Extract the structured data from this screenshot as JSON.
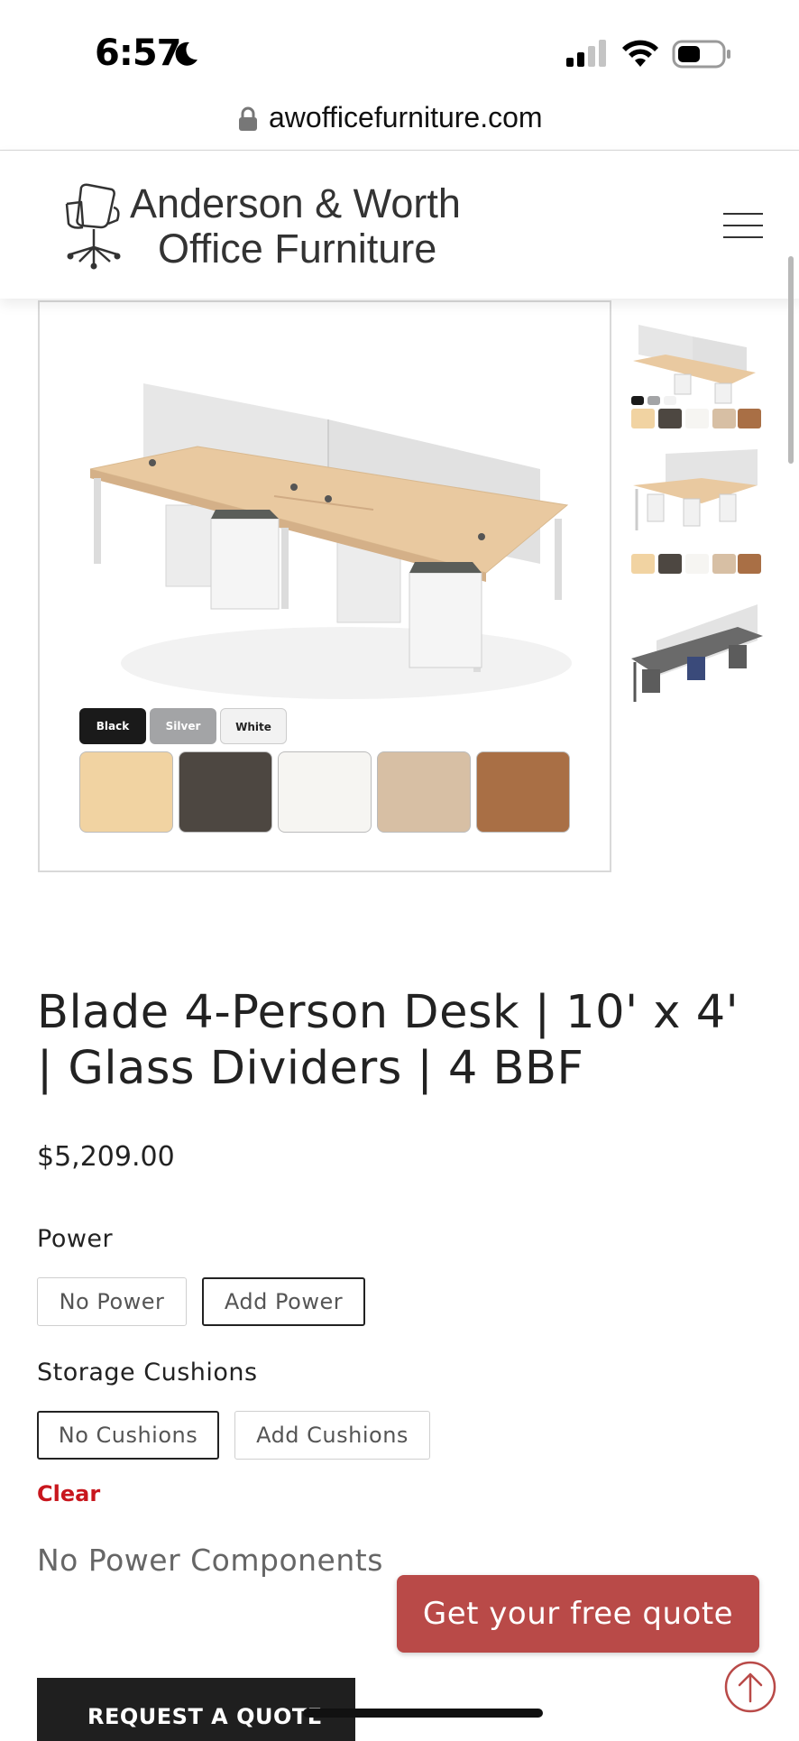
{
  "status_bar": {
    "time": "6:57",
    "moon": "moon-icon",
    "signal": "signal-icon",
    "wifi": "wifi-icon",
    "battery": "battery-icon"
  },
  "browser": {
    "url": "awofficefurniture.com",
    "lock": "lock-icon"
  },
  "header": {
    "logo_line1": "Anderson & Worth",
    "logo_line2": "Office Furniture",
    "logo_icon": "office-chair-icon",
    "menu_icon": "hamburger-menu-icon"
  },
  "gallery": {
    "frame_colors": [
      {
        "label": "Black",
        "color": "#1a1a1a",
        "text_color": "#ffffff"
      },
      {
        "label": "Silver",
        "color": "#a3a4a6",
        "text_color": "#ffffff"
      },
      {
        "label": "White",
        "color": "#f2f2f2",
        "text_color": "#222222"
      }
    ],
    "wood_finishes": [
      "#f1d3a2",
      "#4d4741",
      "#f6f5f2",
      "#d7bfa4",
      "#a96f45"
    ]
  },
  "product": {
    "title": "Blade 4-Person Desk | 10' x 4' | Glass Dividers | 4 BBF",
    "price": "$5,209.00"
  },
  "options": {
    "power": {
      "title": "Power",
      "choices": [
        "No Power",
        "Add Power"
      ],
      "selected": "Add Power"
    },
    "cushions": {
      "title": "Storage Cushions",
      "choices": [
        "No Cushions",
        "Add Cushions"
      ],
      "selected": "No Cushions"
    },
    "clear_label": "Clear",
    "note": "No Power Components"
  },
  "actions": {
    "free_quote": "Get your free quote",
    "request_quote": "REQUEST A QUOTE",
    "scroll_top": "arrow-up-circle-icon"
  },
  "colors": {
    "accent": "#b94a48",
    "clear_link": "#c8161d",
    "request_button": "#1f1f1f"
  }
}
